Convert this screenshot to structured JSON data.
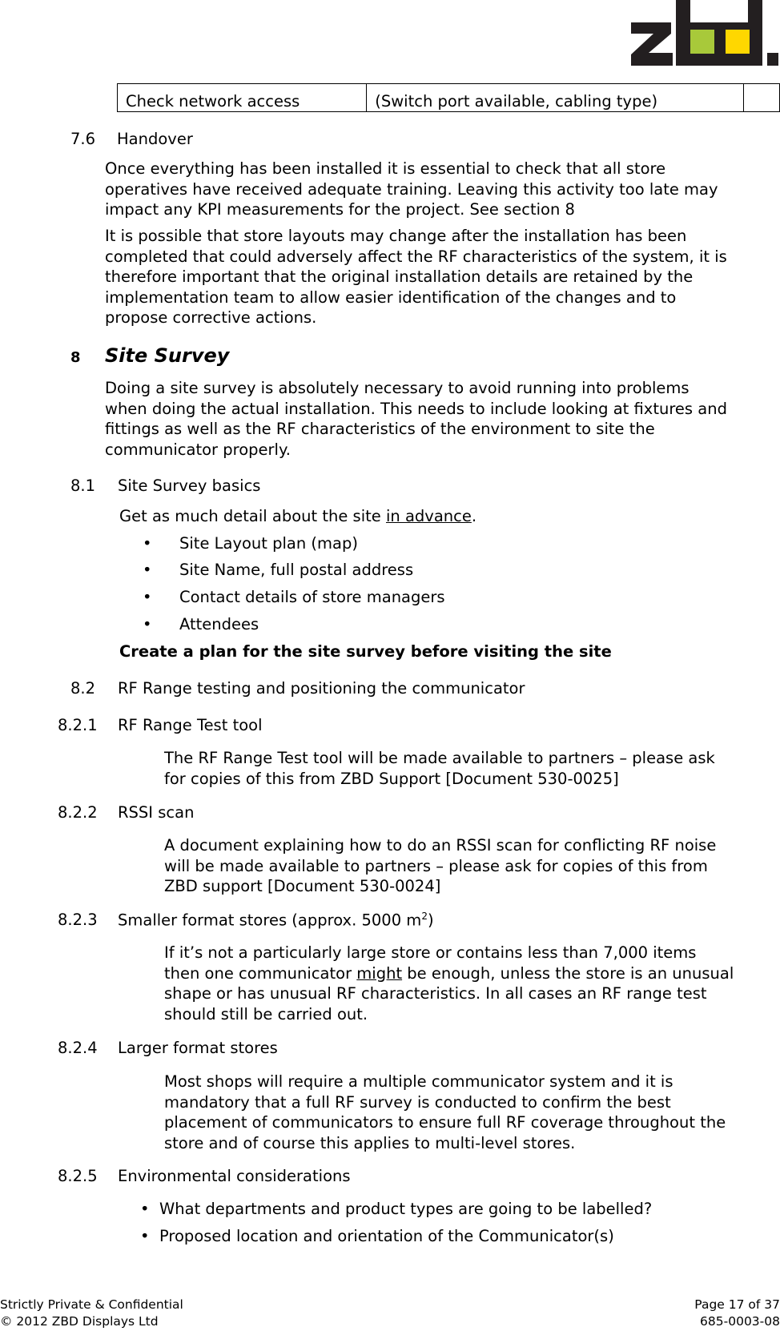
{
  "header": {
    "logo_text": "zbd.",
    "logo_colors": {
      "dark": "#231f20",
      "green": "#a8c93a",
      "yellow": "#ffd700"
    }
  },
  "table_row": {
    "cells": [
      "Check network access",
      "(Switch port available, cabling type)",
      ""
    ]
  },
  "s7_6": {
    "number": "7.6",
    "title": "Handover",
    "paragraphs": [
      [
        "Once everything has been installed it is essential to check that all store",
        "operatives have received adequate training. Leaving this activity too late may",
        "impact any KPI measurements for the project. See section 8"
      ],
      [
        "It is possible that store layouts may change after the installation has been",
        "completed that could adversely affect the RF characteristics of the system, it is",
        "therefore important that the original installation details are retained by the",
        "implementation team to allow easier identification of the changes and to",
        "propose corrective actions."
      ]
    ]
  },
  "s8": {
    "number": "8",
    "title": "Site Survey",
    "paragraph": [
      "Doing a site survey is absolutely necessary to avoid running into problems",
      "when doing the actual installation. This needs to include looking at fixtures and",
      "fittings as well as the RF characteristics of the environment to site the",
      "communicator properly."
    ]
  },
  "s8_1": {
    "number": "8.1",
    "title": "Site Survey basics",
    "intro_prefix": "Get as much detail about the site ",
    "intro_underlined": "in advance",
    "intro_suffix": ".",
    "bullets": [
      "Site Layout plan (map)",
      "Site Name, full postal address",
      "Contact details of store managers",
      "Attendees"
    ],
    "bold_note": "Create a plan for the site survey before visiting the site"
  },
  "s8_2": {
    "number": "8.2",
    "title": "RF Range testing and positioning the communicator"
  },
  "s8_2_1": {
    "number": "8.2.1",
    "title": "RF Range Test tool",
    "lines": [
      "The RF Range Test tool will be made available to partners – please ask",
      "for copies of this from ZBD Support [Document 530-0025]"
    ]
  },
  "s8_2_2": {
    "number": "8.2.2",
    "title": "RSSI scan",
    "lines": [
      "A document explaining how to do an RSSI scan for conflicting RF noise",
      "will be made available to partners – please ask for copies of this from",
      "ZBD support [Document 530-0024]"
    ]
  },
  "s8_2_3": {
    "number": "8.2.3",
    "title_prefix": "Smaller format stores (approx. 5000 m",
    "title_sup": "2",
    "title_suffix": ")",
    "line1": "If it’s not a particularly large store or contains less than 7,000 items",
    "line2_prefix": "then one communicator ",
    "line2_underlined": "might",
    "line2_suffix": " be enough, unless the store is an unusual",
    "line3": "shape or has unusual RF characteristics. In all cases an RF range test",
    "line4": "should still be carried out."
  },
  "s8_2_4": {
    "number": "8.2.4",
    "title": "Larger format stores",
    "lines": [
      "Most shops will require a multiple communicator system and it is",
      "mandatory that a full RF survey is conducted to confirm the best",
      "placement of communicators to ensure full RF coverage throughout the",
      "store and of course this applies to multi-level stores."
    ]
  },
  "s8_2_5": {
    "number": "8.2.5",
    "title": "Environmental considerations",
    "bullets": [
      "What departments and product types are going to be labelled?",
      "Proposed location and orientation of the Communicator(s)"
    ]
  },
  "footer": {
    "left_line1": "Strictly Private & Confidential",
    "left_line2": "© 2012 ZBD Displays Ltd",
    "right_line1": "Page 17 of 37",
    "right_line2": "685-0003-08"
  }
}
